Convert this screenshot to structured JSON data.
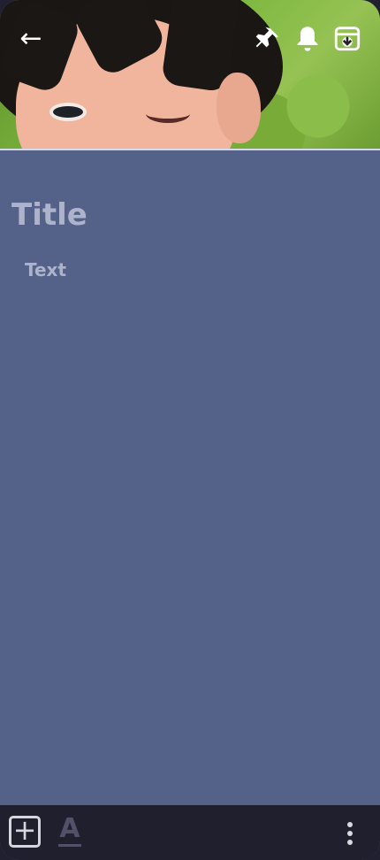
{
  "header": {
    "back_icon": "arrow-left-icon",
    "pin_icon": "pin-icon",
    "reminder_icon": "bell-icon",
    "archive_icon": "archive-down-icon"
  },
  "note": {
    "title_placeholder": "Title",
    "text_placeholder": "Text",
    "background_color": "#546189"
  },
  "bottom_bar": {
    "add_icon": "add-box-icon",
    "format_icon": "text-style-icon",
    "more_icon": "more-vert-icon"
  }
}
